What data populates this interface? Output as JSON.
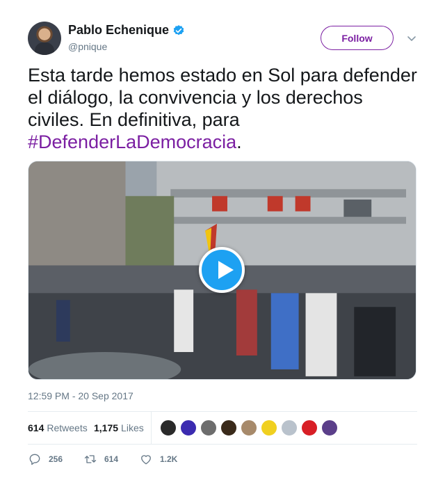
{
  "author": {
    "display_name": "Pablo Echenique",
    "handle": "@pnique",
    "verified": true
  },
  "follow_label": "Follow",
  "tweet": {
    "text": "Esta tarde hemos estado en Sol para defender el diálogo, la convivencia y los derechos civiles. En definitiva, para ",
    "hashtag": "#DefenderLaDemocracia",
    "trailing": "."
  },
  "media": {
    "type": "video",
    "icon": "play-icon"
  },
  "timestamp": "12:59 PM - 20 Sep 2017",
  "stats": {
    "retweets_count": "614",
    "retweets_label": "Retweets",
    "likes_count": "1,175",
    "likes_label": "Likes"
  },
  "liker_avatars": [
    "#2a2a2a",
    "#3b2bb0",
    "#6d6d6d",
    "#3a2a1a",
    "#a78a6b",
    "#f0d020",
    "#b9c2cc",
    "#d81f26",
    "#5b3f8a"
  ],
  "actions": {
    "reply_count": "256",
    "retweet_count": "614",
    "like_count": "1.2K"
  },
  "colors": {
    "accent": "#7b1fa2",
    "verified": "#1da1f2",
    "muted": "#657786"
  }
}
